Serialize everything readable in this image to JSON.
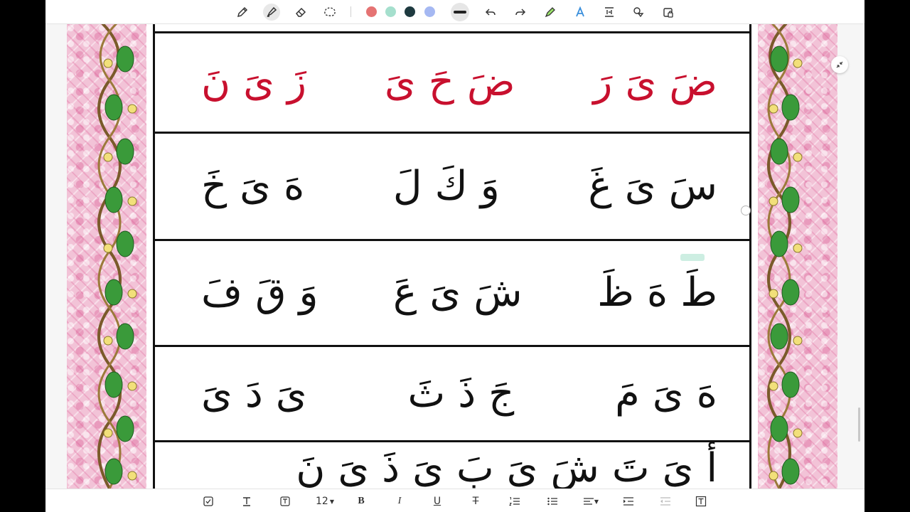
{
  "toolbar": {
    "tools": [
      {
        "name": "pencil-icon"
      },
      {
        "name": "highlighter-icon",
        "selected": true
      },
      {
        "name": "eraser-icon"
      },
      {
        "name": "lasso-icon"
      }
    ],
    "colors": [
      "#e57373",
      "#a5dfcd",
      "#1e3a40",
      "#a5b8f2"
    ],
    "stroke": "thick",
    "actions": [
      "undo-icon",
      "redo-icon",
      "marker-icon",
      "text-style-icon",
      "text-box-icon",
      "shapes-icon",
      "lock-icon"
    ]
  },
  "worksheet": {
    "row1": {
      "color": "#c8102e",
      "groups": [
        [
          "ضَ",
          "ىَ",
          "رَ"
        ],
        [
          "ضَ",
          "حَ",
          "ىَ"
        ],
        [
          "زَ",
          "ىَ",
          "نَ"
        ]
      ]
    },
    "row2": {
      "groups": [
        [
          "سَ",
          "ىَ",
          "غَ"
        ],
        [
          "وَ",
          "كَ",
          "لَ"
        ],
        [
          "هَ",
          "ىَ",
          "خَ"
        ]
      ]
    },
    "row3": {
      "groups": [
        [
          "طَ",
          "هَ",
          "ظَ"
        ],
        [
          "شَ",
          "ىَ",
          "عَ"
        ],
        [
          "وَ",
          "قَ",
          "فَ"
        ]
      ]
    },
    "row4": {
      "groups": [
        [
          "هَ",
          "ىَ",
          "مَ"
        ],
        [
          "جَ",
          "ذَ",
          "ثَ"
        ],
        [
          "ىَ",
          "دَ",
          "ىَ"
        ]
      ]
    },
    "row5": {
      "groups": [
        [
          "أَ",
          "ىَ",
          "تَ",
          "شَ",
          "ىَ",
          "بَ",
          "ىَ",
          "ذَ",
          "ىَ",
          "نَ"
        ]
      ]
    }
  },
  "bottom_toolbar": {
    "font_size": "12",
    "items": [
      "checkbox-icon",
      "text-icon",
      "text-field-icon",
      "bold-icon",
      "italic-icon",
      "underline-icon",
      "strikethrough-icon",
      "numbered-list-icon",
      "bullet-list-icon",
      "align-icon",
      "indent-icon",
      "outdent-icon",
      "text-box-icon"
    ],
    "labels": {
      "bold": "B",
      "italic": "I",
      "underline": "U",
      "strike": "T"
    }
  }
}
